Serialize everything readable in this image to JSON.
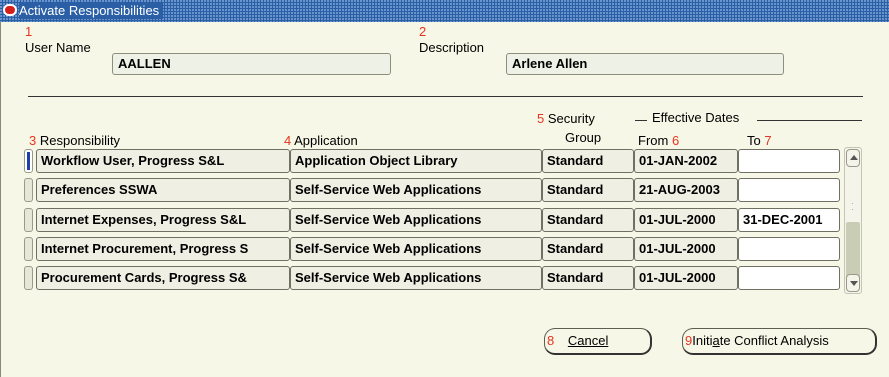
{
  "window": {
    "title": "Activate Responsibilities"
  },
  "header": {
    "user_name": {
      "number": "1",
      "label": "User Name",
      "value": "AALLEN"
    },
    "description": {
      "number": "2",
      "label": "Description",
      "value": "Arlene Allen"
    }
  },
  "columns": {
    "responsibility": {
      "number": "3",
      "label": "Responsibility"
    },
    "application": {
      "number": "4",
      "label": "Application"
    },
    "security_group": {
      "number": "5",
      "label_line1": "Security",
      "label_line2": "Group"
    },
    "effective_dates": {
      "label": "Effective Dates"
    },
    "from": {
      "label": "From",
      "number": "6"
    },
    "to": {
      "label": "To",
      "number": "7"
    }
  },
  "rows": [
    {
      "responsibility": "Workflow User, Progress S&L",
      "application": "Application Object Library",
      "security_group": "Standard",
      "from": "01-JAN-2002",
      "to": ""
    },
    {
      "responsibility": "Preferences SSWA",
      "application": "Self-Service Web Applications",
      "security_group": "Standard",
      "from": "21-AUG-2003",
      "to": ""
    },
    {
      "responsibility": "Internet Expenses, Progress S&L",
      "application": "Self-Service Web Applications",
      "security_group": "Standard",
      "from": "01-JUL-2000",
      "to": "31-DEC-2001"
    },
    {
      "responsibility": "Internet Procurement, Progress S",
      "application": "Self-Service Web Applications",
      "security_group": "Standard",
      "from": "01-JUL-2000",
      "to": ""
    },
    {
      "responsibility": "Procurement Cards, Progress S&",
      "application": "Self-Service Web Applications",
      "security_group": "Standard",
      "from": "01-JUL-2000",
      "to": ""
    }
  ],
  "buttons": {
    "cancel": {
      "number": "8",
      "label": "Cancel"
    },
    "initiate": {
      "number": "9",
      "label_pre": "Initi",
      "label_mnemonic": "a",
      "label_post": "te Conflict Analysis"
    }
  },
  "colors": {
    "title_bar": "#2a5fa6",
    "annotation": "#e8341f",
    "background": "#f7f7e7"
  },
  "icons": {
    "title_logo": "oracle-logo-icon",
    "scroll_up": "arrow-up-icon",
    "scroll_down": "arrow-down-icon"
  }
}
